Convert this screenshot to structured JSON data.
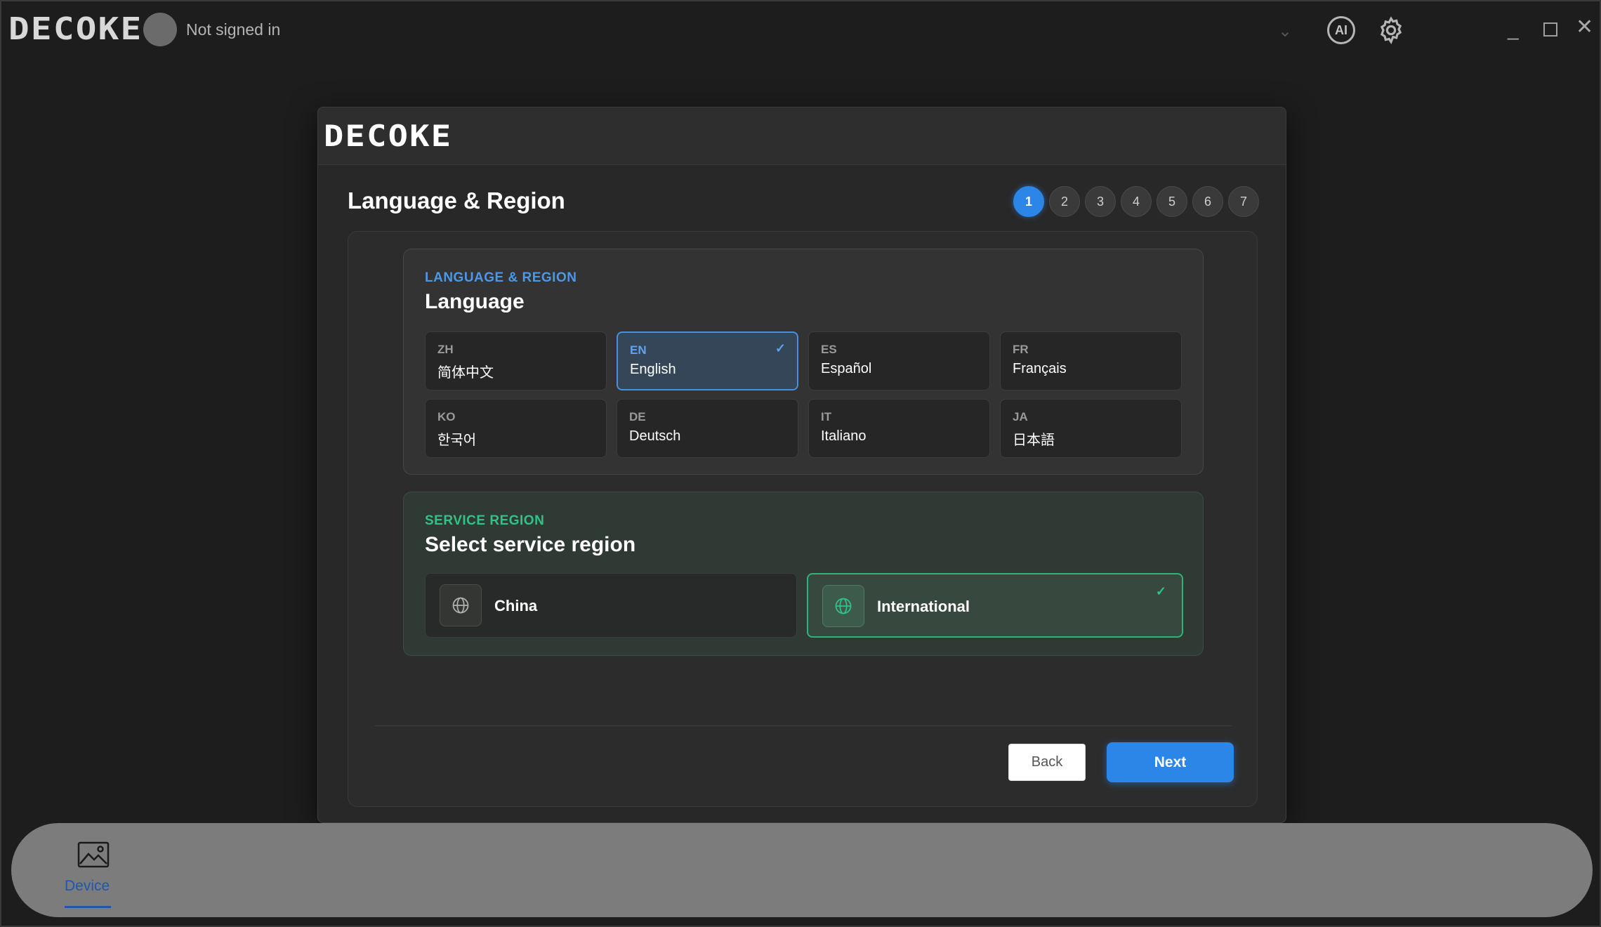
{
  "app": {
    "logo_text": "DECOKE",
    "user_status": "Not signed in",
    "ai_label": "AI",
    "icons": [
      "chevron-down-icon",
      "ai-icon",
      "gear-icon",
      "minimize-icon",
      "maximize-icon",
      "close-icon"
    ]
  },
  "dialog": {
    "logo_text": "DECOKE",
    "title": "Language & Region",
    "steps": [
      "1",
      "2",
      "3",
      "4",
      "5",
      "6",
      "7"
    ],
    "active_step": 1,
    "language_section": {
      "kicker": "LANGUAGE & REGION",
      "title": "Language",
      "options": [
        {
          "code": "ZH",
          "name": "简体中文",
          "selected": false
        },
        {
          "code": "EN",
          "name": "English",
          "selected": true
        },
        {
          "code": "ES",
          "name": "Español",
          "selected": false
        },
        {
          "code": "FR",
          "name": "Français",
          "selected": false
        },
        {
          "code": "KO",
          "name": "한국어",
          "selected": false
        },
        {
          "code": "DE",
          "name": "Deutsch",
          "selected": false
        },
        {
          "code": "IT",
          "name": "Italiano",
          "selected": false
        },
        {
          "code": "JA",
          "name": "日本語",
          "selected": false
        }
      ]
    },
    "region_section": {
      "kicker": "SERVICE REGION",
      "title": "Select service region",
      "options": [
        {
          "name": "China",
          "selected": false
        },
        {
          "name": "International",
          "selected": true
        }
      ]
    },
    "buttons": {
      "back": "Back",
      "next": "Next"
    }
  },
  "dock": {
    "items": [
      {
        "label": "Device",
        "icon": "image-icon",
        "active": true
      }
    ]
  },
  "colors": {
    "accent_blue": "#2b86e8",
    "accent_green": "#2fc386",
    "background": "#1d1d1d"
  }
}
